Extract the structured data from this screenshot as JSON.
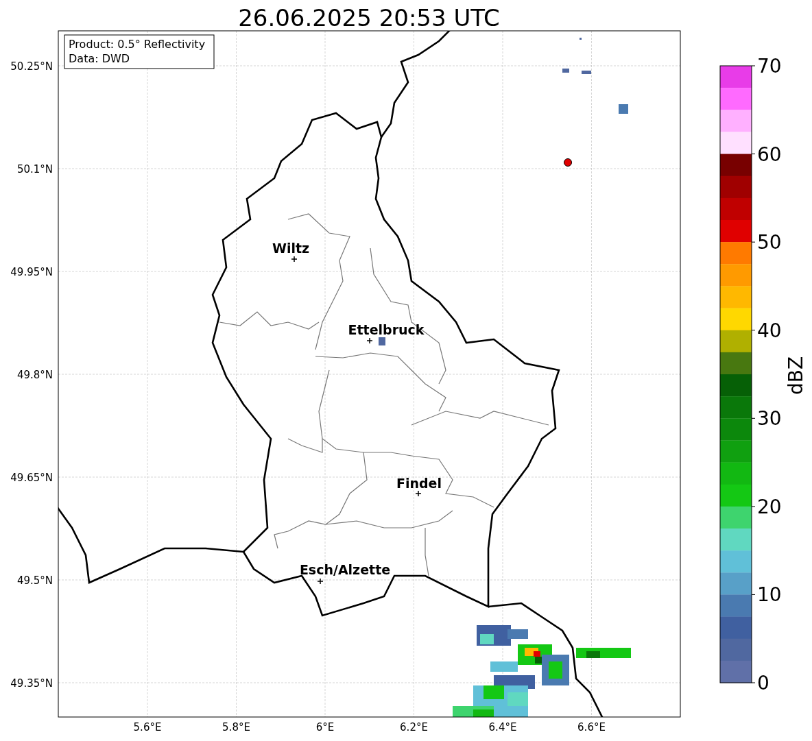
{
  "title": "26.06.2025 20:53 UTC",
  "info_box": [
    "Product: 0.5° Reflectivity",
    "Data: DWD"
  ],
  "cities": [
    {
      "name": "Wiltz"
    },
    {
      "name": "Ettelbruck"
    },
    {
      "name": "Findel"
    },
    {
      "name": "Esch/Alzette"
    }
  ],
  "y_ticks": [
    "50.25°N",
    "50.1°N",
    "49.95°N",
    "49.8°N",
    "49.65°N",
    "49.5°N",
    "49.35°N"
  ],
  "x_ticks": [
    "5.6°E",
    "5.8°E",
    "6°E",
    "6.2°E",
    "6.4°E",
    "6.6°E"
  ],
  "colorbar": {
    "label": "dBZ",
    "ticks": [
      "70",
      "60",
      "50",
      "40",
      "30",
      "20",
      "10",
      "0"
    ],
    "segments": [
      {
        "color": "#e83ce8"
      },
      {
        "color": "#ff6aff"
      },
      {
        "color": "#ffb0ff"
      },
      {
        "color": "#ffe0ff"
      },
      {
        "color": "#780000"
      },
      {
        "color": "#a00000"
      },
      {
        "color": "#c00000"
      },
      {
        "color": "#e00000"
      },
      {
        "color": "#ff7a00"
      },
      {
        "color": "#ff9a00"
      },
      {
        "color": "#ffb800"
      },
      {
        "color": "#ffd800"
      },
      {
        "color": "#b0b000"
      },
      {
        "color": "#487810"
      },
      {
        "color": "#066006"
      },
      {
        "color": "#0a780a"
      },
      {
        "color": "#0c880c"
      },
      {
        "color": "#10a010"
      },
      {
        "color": "#12b812"
      },
      {
        "color": "#14c814"
      },
      {
        "color": "#3ed46e"
      },
      {
        "color": "#60d8c0"
      },
      {
        "color": "#60c0d8"
      },
      {
        "color": "#58a0c8"
      },
      {
        "color": "#4a7ab0"
      },
      {
        "color": "#4060a0"
      },
      {
        "color": "#5068a0"
      },
      {
        "color": "#6070a8"
      }
    ]
  }
}
